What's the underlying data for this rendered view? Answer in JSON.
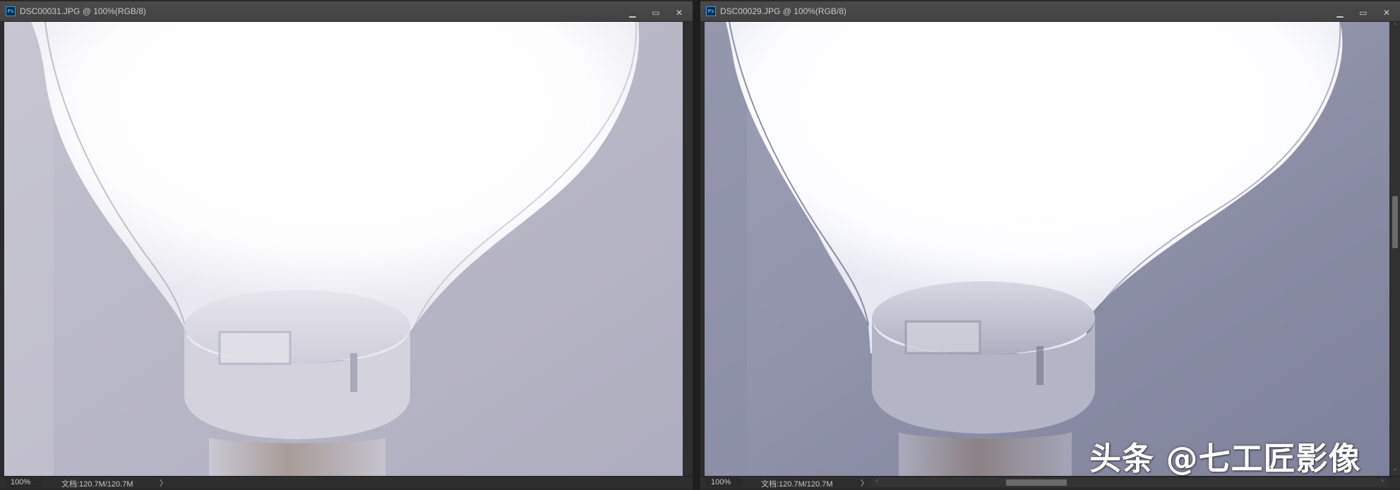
{
  "windows": [
    {
      "title": "DSC00031.JPG @ 100%(RGB/8)",
      "zoom": "100%",
      "doc_info": "文档:120.7M/120.7M",
      "status_arrow": "〉"
    },
    {
      "title": "DSC00029.JPG @ 100%(RGB/8)",
      "zoom": "100%",
      "doc_info": "文档:120.7M/120.7M",
      "status_arrow": "〉"
    }
  ],
  "window_controls": {
    "minimize": "▁",
    "restore": "▭",
    "close": "✕"
  },
  "icons": {
    "app": "photoshop-icon",
    "app_glyph": "Ps",
    "scroll_left": "‹",
    "scroll_right": "›",
    "scroll_up": "˄",
    "scroll_down": "˅"
  },
  "watermark": "头条 @七工匠影像",
  "colors": {
    "bulb_white": "#fbfbfd",
    "background_left": "#b7b6c4",
    "background_right": "#8c8fa6",
    "accent": "#35a7f5"
  }
}
